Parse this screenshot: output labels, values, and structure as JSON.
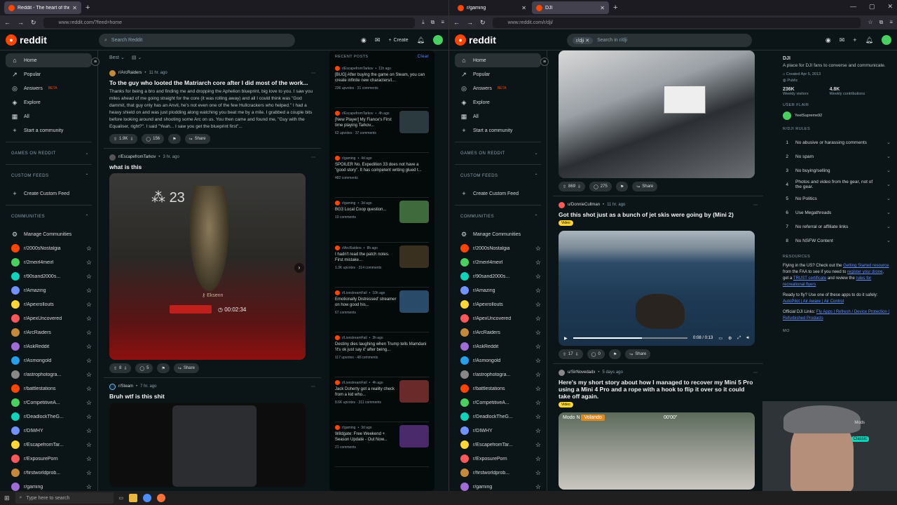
{
  "left": {
    "tabs": [
      {
        "title": "Reddit - The heart of the intern"
      }
    ],
    "url": "www.reddit.com/?feed=home",
    "logo": "reddit",
    "search_placeholder": "Search Reddit",
    "create": "Create",
    "nav": [
      {
        "label": "Home",
        "icon": "⌂"
      },
      {
        "label": "Popular",
        "icon": "↗"
      },
      {
        "label": "Answers",
        "icon": "◎",
        "badge": "BETA"
      },
      {
        "label": "Explore",
        "icon": "◈"
      },
      {
        "label": "All",
        "icon": "▦"
      },
      {
        "label": "Start a community",
        "icon": "+"
      }
    ],
    "sections": {
      "games": "GAMES ON REDDIT",
      "custom": "CUSTOM FEEDS",
      "create_feed": "Create Custom Feed",
      "communities": "COMMUNITIES",
      "manage": "Manage Communities"
    },
    "communities": [
      "r/2000sNostalgia",
      "r/2meirl4meirl",
      "r/90sand2000s...",
      "r/Amazing",
      "r/Apexrollouts",
      "r/ApexUncovered",
      "r/ArcRaiders",
      "r/AskReddit",
      "r/Asmongold",
      "r/astrophotogra...",
      "r/battlestations",
      "r/CompetitiveA...",
      "r/DeadlockTheG...",
      "r/DIWHY",
      "r/EscapefromTar...",
      "r/ExposurePorn",
      "r/firstworldprob...",
      "r/gaming"
    ],
    "sort": "Best",
    "posts": [
      {
        "sub": "r/ArcRaiders",
        "time": "11 hr. ago",
        "title": "To the guy who looted the Matriarch core after I did most of the work...",
        "body": "Thanks for being a bro and finding me and dropping the Aphelion blueprint, big love to you. I saw you miles ahead of me going straight for the core (it was rolling away) and all I could think was \"God dammit, that guy only has an Anvil, he's not even one of the few Hullcrackers who helped.\" I had a heavy shield on and was just plodding along watching you beat me by a mile. I grabbed a couple bits before looking around and shooting some Arc on us. You then came and found me, \"Guy with the Equaliser, right?\". I said \"Yeah... I saw you get the blueprint first\"...",
        "votes": "1.9K",
        "comments": "156",
        "share": "Share"
      },
      {
        "sub": "r/EscapefromTarkov",
        "time": "3 hr. ago",
        "title": "what is this",
        "votes": "8",
        "comments": "5",
        "share": "Share",
        "overlay_num": "23",
        "overlay_timer": "00:02:34",
        "overlay_name": "Eksenn"
      },
      {
        "sub": "r/Steam",
        "time": "7 hr. ago",
        "title": "Bruh wtf is this shit"
      }
    ],
    "recent": {
      "header": "RECENT POSTS",
      "clear": "Clear",
      "items": [
        {
          "sub": "r/EscapefromTarkov",
          "time": "11h ago",
          "title": "[BUG] After buying the game on Steam, you can create infinite new characters/i...",
          "stats": "236 upvotes · 31 comments",
          "thumb": ""
        },
        {
          "sub": "r/EscapefromTarkov",
          "time": "4h ago",
          "title": "[New Player] My Fiance's First time playing Tarkov...",
          "stats": "62 upvotes · 37 comments",
          "thumb": "#2b3a3f"
        },
        {
          "sub": "r/gaming",
          "time": "4d ago",
          "title": "SPOILER No. Expedition 33 does not have a \"good story\". It has competent writing glued t...",
          "stats": "482 comments",
          "thumb": ""
        },
        {
          "sub": "r/gaming",
          "time": "3d ago",
          "title": "BG3 Local Coop question...",
          "stats": "10 comments",
          "thumb": "#3f6a3c"
        },
        {
          "sub": "r/ArcRaiders",
          "time": "8h ago",
          "title": "I hadn't read the patch notes. First mistake...",
          "stats": "1.3K upvotes · 314 comments",
          "thumb": "#3a3020"
        },
        {
          "sub": "r/LivestreamFail",
          "time": "10h ago",
          "title": "Emotionally Distressed' streamer on how good his...",
          "stats": "67 comments",
          "thumb": "#2a4a6a"
        },
        {
          "sub": "r/LivestreamFail",
          "time": "3h ago",
          "title": "Destiny dies laughing when Trump tells Mamdani 'it's ok just say it' after being...",
          "stats": "117 upvotes · 48 comments",
          "thumb": ""
        },
        {
          "sub": "r/LivestreamFail",
          "time": "4h ago",
          "title": "Jack Doherty got a reality check from a kid who...",
          "stats": "8.6K upvotes · 311 comments",
          "thumb": "#6a2a2a"
        },
        {
          "sub": "r/gaming",
          "time": "3d ago",
          "title": "Wildgate: Free Weekend + Season Update - Out Now...",
          "stats": "21 comments",
          "thumb": "#4a2a6a"
        }
      ]
    }
  },
  "right": {
    "tabs": [
      {
        "title": "r/gaming"
      },
      {
        "title": "DJI"
      }
    ],
    "url": "www.reddit.com/r/dji/",
    "logo": "reddit",
    "search_chip": "r/dji",
    "search_placeholder": "Search in r/dji",
    "nav": [
      {
        "label": "Home",
        "icon": "⌂"
      },
      {
        "label": "Popular",
        "icon": "↗"
      },
      {
        "label": "Answers",
        "icon": "◎",
        "badge": "BETA"
      },
      {
        "label": "Explore",
        "icon": "◈"
      },
      {
        "label": "All",
        "icon": "▦"
      },
      {
        "label": "Start a community",
        "icon": "+"
      }
    ],
    "sections": {
      "games": "GAMES ON REDDIT",
      "custom": "CUSTOM FEEDS",
      "create_feed": "Create Custom Feed",
      "communities": "COMMUNITIES",
      "manage": "Manage Communities"
    },
    "communities": [
      "r/2000sNostalgia",
      "r/2meirl4meirl",
      "r/90sand2000s...",
      "r/Amazing",
      "r/Apexrollouts",
      "r/ApexUncovered",
      "r/ArcRaiders",
      "r/AskReddit",
      "r/Asmongold",
      "r/astrophotogra...",
      "r/battlestations",
      "r/CompetitiveA...",
      "r/DeadlockTheG...",
      "r/DIWHY",
      "r/EscapefromTar...",
      "r/ExposurePorn",
      "r/firstworldprob...",
      "r/gaming"
    ],
    "posts": [
      {
        "votes": "869",
        "comments": "275",
        "share": "Share"
      },
      {
        "user": "u/DonnieCullman",
        "time": "11 hr. ago",
        "title": "Got this shot just as a bunch of jet skis were going by (Mini 2)",
        "flair": "Video",
        "time_display": "0:08 / 0:13",
        "progress": 0.6,
        "votes": "17",
        "comments": "0",
        "share": "Share"
      },
      {
        "user": "u/SirNovedadx",
        "time": "5 days ago",
        "title": "Here's my short story about how I managed to recover my Mini 5 Pro using a Mini 4 Pro and a rope with a hook to flip it over so it could take off again.",
        "flair": "Video",
        "overlay_mode": "Modo N",
        "overlay_fly": "Volando",
        "overlay_speed": "00'00\""
      }
    ],
    "about": {
      "name": "DJI",
      "desc": "A place for DJI fans to converse and communicate.",
      "created": "Created Apr 5, 2013",
      "visibility": "Public",
      "stat1": "236K",
      "stat1_label": "Weekly visitors",
      "stat2": "4.8K",
      "stat2_label": "Weekly contributions",
      "flair_head": "USER FLAIR",
      "flair_user": "YeetSupreme92",
      "rules_head": "R/DJI RULES",
      "rules": [
        "No abusive or harassing comments",
        "No spam",
        "No buying/selling",
        "Photos and video from the gear, not of the gear.",
        "No Politics",
        "Use Megathreads",
        "No referral or affiliate links",
        "No NSFW Content"
      ],
      "resources_head": "RESOURCES",
      "res1": "Flying in the US? Check out the",
      "res1_link": "Getting Started resource",
      "res1_b": "from the FAA to see if you need to",
      "res1_link2": "register your drone",
      "res1_c": ", get a",
      "res1_link3": "TRUST certificate",
      "res1_d": "and review the",
      "res1_link4": "rules for recreational flyers",
      "res2": "Ready to fly? Use one of these apps to do it safely:",
      "res2_links": "AutoPilot | Air Aware | Air Control",
      "res3": "Official DJI Links:",
      "res3_links": "Fly Apps | Refresh / Device Protection | Refurbished Products",
      "mods_head": "MO"
    }
  },
  "taskbar": {
    "search": "Type here to search"
  },
  "webcam": {
    "label1": "Mods",
    "label2": "Classic"
  }
}
